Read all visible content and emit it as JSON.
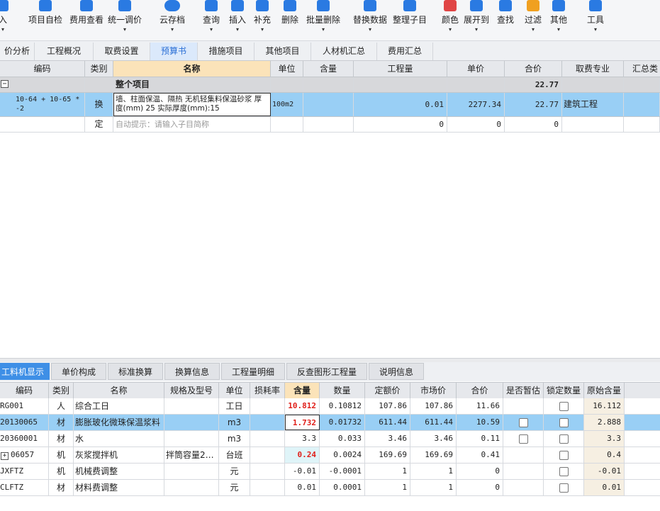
{
  "toolbar": {
    "items": [
      {
        "label": "入",
        "color": "#2a7ae2"
      },
      {
        "label": "项目自检",
        "color": "#2a7ae2"
      },
      {
        "label": "费用查看",
        "color": "#2a7ae2"
      },
      {
        "label": "统一调价",
        "color": "#2a7ae2"
      },
      {
        "label": "云存档",
        "color": "#2a7ae2"
      },
      {
        "label": "查询",
        "color": "#2a7ae2"
      },
      {
        "label": "插入",
        "color": "#2a7ae2"
      },
      {
        "label": "补充",
        "color": "#2a7ae2"
      },
      {
        "label": "删除",
        "color": "#2a7ae2"
      },
      {
        "label": "批量删除",
        "color": "#2a7ae2"
      },
      {
        "label": "替换数据",
        "color": "#2a7ae2"
      },
      {
        "label": "整理子目",
        "color": "#2a7ae2"
      },
      {
        "label": "颜色",
        "color": "#e04545"
      },
      {
        "label": "展开到",
        "color": "#2a7ae2"
      },
      {
        "label": "查找",
        "color": "#2a7ae2"
      },
      {
        "label": "过滤",
        "color": "#f0a020"
      },
      {
        "label": "其他",
        "color": "#2a7ae2"
      },
      {
        "label": "工具",
        "color": "#2a7ae2"
      }
    ],
    "arrow": "▾"
  },
  "top_tabs": [
    "价分析",
    "工程概况",
    "取费设置",
    "预算书",
    "措施项目",
    "其他项目",
    "人材机汇总",
    "费用汇总"
  ],
  "grid": {
    "headers": [
      "编码",
      "类别",
      "名称",
      "单位",
      "含量",
      "工程量",
      "单价",
      "合价",
      "取费专业",
      "汇总类"
    ],
    "root": {
      "toggle": "−",
      "name": "整个项目",
      "total": "22.77"
    },
    "item": {
      "code": "10-64 + 10-65 * -2",
      "type": "换",
      "name": "墙、柱面保温、隔热 无机轻集料保温砂浆 厚度(mm) 25  实际厚度(mm):15",
      "unit": "100m2",
      "qty": "0.01",
      "price": "2277.34",
      "total": "22.77",
      "specialty": "建筑工程"
    },
    "new_row": {
      "type": "定",
      "hint": "自动提示：请输入子目简称",
      "qty": "0",
      "price": "0",
      "total": "0"
    }
  },
  "bottom_tabs": [
    "工料机显示",
    "单价构成",
    "标准换算",
    "换算信息",
    "工程量明细",
    "反查图形工程量",
    "说明信息"
  ],
  "materials": {
    "headers": [
      "编码",
      "类别",
      "名称",
      "规格及型号",
      "单位",
      "损耗率",
      "含量",
      "数量",
      "定额价",
      "市场价",
      "合价",
      "是否暂估",
      "锁定数量",
      "原始含量"
    ],
    "rows": [
      {
        "code": "RG001",
        "type": "人",
        "name": "综合工日",
        "spec": "",
        "unit": "工日",
        "loss": "",
        "content": "10.812",
        "amount": "0.10812",
        "fixed": "107.86",
        "market": "107.86",
        "total": "11.66",
        "estimate": false,
        "lock": true,
        "orig": "16.112"
      },
      {
        "code": "20130065",
        "type": "材",
        "name": "膨胀玻化微珠保温浆料",
        "spec": "",
        "unit": "m3",
        "loss": "",
        "content": "1.732",
        "amount": "0.01732",
        "fixed": "611.44",
        "market": "611.44",
        "total": "10.59",
        "estimate": true,
        "lock": true,
        "orig": "2.888"
      },
      {
        "code": "20360001",
        "type": "材",
        "name": "水",
        "spec": "",
        "unit": "m3",
        "loss": "",
        "content": "3.3",
        "amount": "0.033",
        "fixed": "3.46",
        "market": "3.46",
        "total": "0.11",
        "estimate": true,
        "lock": true,
        "orig": "3.3"
      },
      {
        "code": "06057",
        "expand": "+",
        "type": "机",
        "name": "灰浆搅拌机",
        "spec": "拌筒容量2…",
        "unit": "台班",
        "loss": "",
        "content": "0.24",
        "amount": "0.0024",
        "fixed": "169.69",
        "market": "169.69",
        "total": "0.41",
        "estimate": false,
        "lock": true,
        "orig": "0.4"
      },
      {
        "code": "JXFTZ",
        "type": "机",
        "name": "机械费调整",
        "spec": "",
        "unit": "元",
        "loss": "",
        "content": "-0.01",
        "amount": "-0.0001",
        "fixed": "1",
        "market": "1",
        "total": "0",
        "estimate": false,
        "lock": true,
        "orig": "-0.01"
      },
      {
        "code": "CLFTZ",
        "type": "材",
        "name": "材料费调整",
        "spec": "",
        "unit": "元",
        "loss": "",
        "content": "0.01",
        "amount": "0.0001",
        "fixed": "1",
        "market": "1",
        "total": "0",
        "estimate": false,
        "lock": true,
        "orig": "0.01"
      }
    ]
  }
}
